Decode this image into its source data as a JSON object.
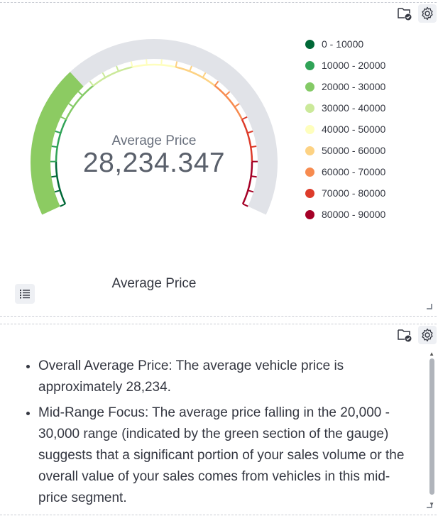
{
  "gauge": {
    "label": "Average Price",
    "value_text": "28,234.347",
    "value": 28234.347,
    "min": 0,
    "max": 90000,
    "title": "Average Price",
    "track_color": "#e1e3e8",
    "fill_color": "#8ccb62",
    "legend": [
      {
        "label": "0 - 10000",
        "color": "#006837",
        "from": 0,
        "to": 10000
      },
      {
        "label": "10000 - 20000",
        "color": "#30a357",
        "from": 10000,
        "to": 20000
      },
      {
        "label": "20000 - 30000",
        "color": "#84ca66",
        "from": 20000,
        "to": 30000
      },
      {
        "label": "30000 - 40000",
        "color": "#cbe99a",
        "from": 30000,
        "to": 40000
      },
      {
        "label": "40000 - 50000",
        "color": "#fefebd",
        "from": 40000,
        "to": 50000
      },
      {
        "label": "50000 - 60000",
        "color": "#fdd283",
        "from": 50000,
        "to": 60000
      },
      {
        "label": "60000 - 70000",
        "color": "#f78b4f",
        "from": 60000,
        "to": 70000
      },
      {
        "label": "70000 - 80000",
        "color": "#dd3b2a",
        "from": 70000,
        "to": 80000
      },
      {
        "label": "80000 - 90000",
        "color": "#a50026",
        "from": 80000,
        "to": 90000
      }
    ]
  },
  "top_panel": {
    "icons": [
      "folder-check-icon",
      "gear-icon",
      "list-icon",
      "resize-handle-icon"
    ]
  },
  "bottom_panel": {
    "icons": [
      "folder-check-icon",
      "gear-icon",
      "resize-handle-icon"
    ],
    "bullets": [
      "Overall Average Price: The average vehicle price is approximately 28,234.",
      "Mid-Range Focus: The average price falling in the 20,000 - 30,000 range (indicated by the green section of the gauge) suggests that a significant portion of your sales volume or the overall value of your sales comes from vehicles in this mid-price segment."
    ]
  }
}
